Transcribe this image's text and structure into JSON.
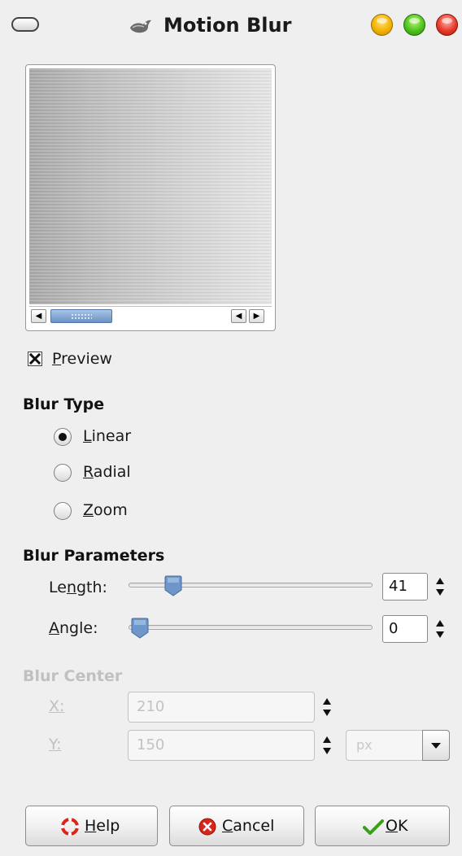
{
  "window": {
    "title": "Motion Blur"
  },
  "preview": {
    "checkbox_checked": true,
    "label_mnemonic": "P",
    "label_rest": "review"
  },
  "blur_type": {
    "title": "Blur Type",
    "options": [
      {
        "mnemonic": "L",
        "rest": "inear",
        "selected": true
      },
      {
        "mnemonic": "R",
        "rest": "adial",
        "selected": false
      },
      {
        "mnemonic": "Z",
        "rest": "oom",
        "selected": false
      }
    ]
  },
  "blur_parameters": {
    "title": "Blur Parameters",
    "length": {
      "label_pre": "Le",
      "label_mnemonic": "n",
      "label_post": "gth:",
      "value": "41"
    },
    "angle": {
      "label_pre": "",
      "label_mnemonic": "A",
      "label_post": "ngle:",
      "value": "0"
    }
  },
  "blur_center": {
    "title": "Blur Center",
    "x": {
      "label": "X:",
      "value": "210"
    },
    "y": {
      "label": "Y:",
      "value": "150"
    },
    "unit": "px"
  },
  "buttons": {
    "help": {
      "mnemonic": "H",
      "rest": "elp"
    },
    "cancel": {
      "mnemonic": "C",
      "rest": "ancel"
    },
    "ok": {
      "mnemonic": "O",
      "rest": "K"
    }
  },
  "colors": {
    "accent_blue": "#6b92c5",
    "disabled_text": "#c0c0c0",
    "ok_check": "#3aa018",
    "cancel_red": "#d8261b"
  },
  "icons": {
    "menu": "window-menu-icon",
    "app": "gimp-wilber-icon",
    "minimize": "minimize-icon",
    "maximize": "maximize-icon",
    "close": "close-icon",
    "help": "lifebuoy-icon",
    "cancel": "cancel-icon",
    "ok": "checkmark-icon"
  }
}
